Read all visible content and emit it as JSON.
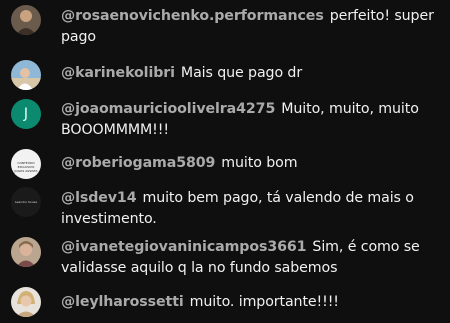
{
  "comments": [
    {
      "user": "@rosaenovichenko.performances",
      "text": "perfeito! super pago"
    },
    {
      "user": "@karinekolibri",
      "text": "Mais que pago dr"
    },
    {
      "user": "@joaomauricioolivelra4275",
      "text": "Muito, muito, muito BOOOMMMM!!!",
      "avatar_letter": "J"
    },
    {
      "user": "@roberiogama5809",
      "text": "muito bom",
      "avatar_logo_text": "CONTEÚDO EXCLUSIVO JOGOS ASSISTA"
    },
    {
      "user": "@lsdev14",
      "text": "muito bem pago, tá valendo de mais o investimento.",
      "avatar_logo_text": "Leandro Sousa"
    },
    {
      "user": "@ivanetegiovaninicampos3661",
      "text": "Sim, é como se validasse aquilo q la no fundo sabemos"
    },
    {
      "user": "@leylharossetti",
      "text": "muito. importante!!!!"
    }
  ],
  "colors": {
    "background": "#0f0f0f",
    "username": "#aaaaaa",
    "text": "#f1f1f1",
    "avatar_letter_bg": "#0b8a6f"
  }
}
